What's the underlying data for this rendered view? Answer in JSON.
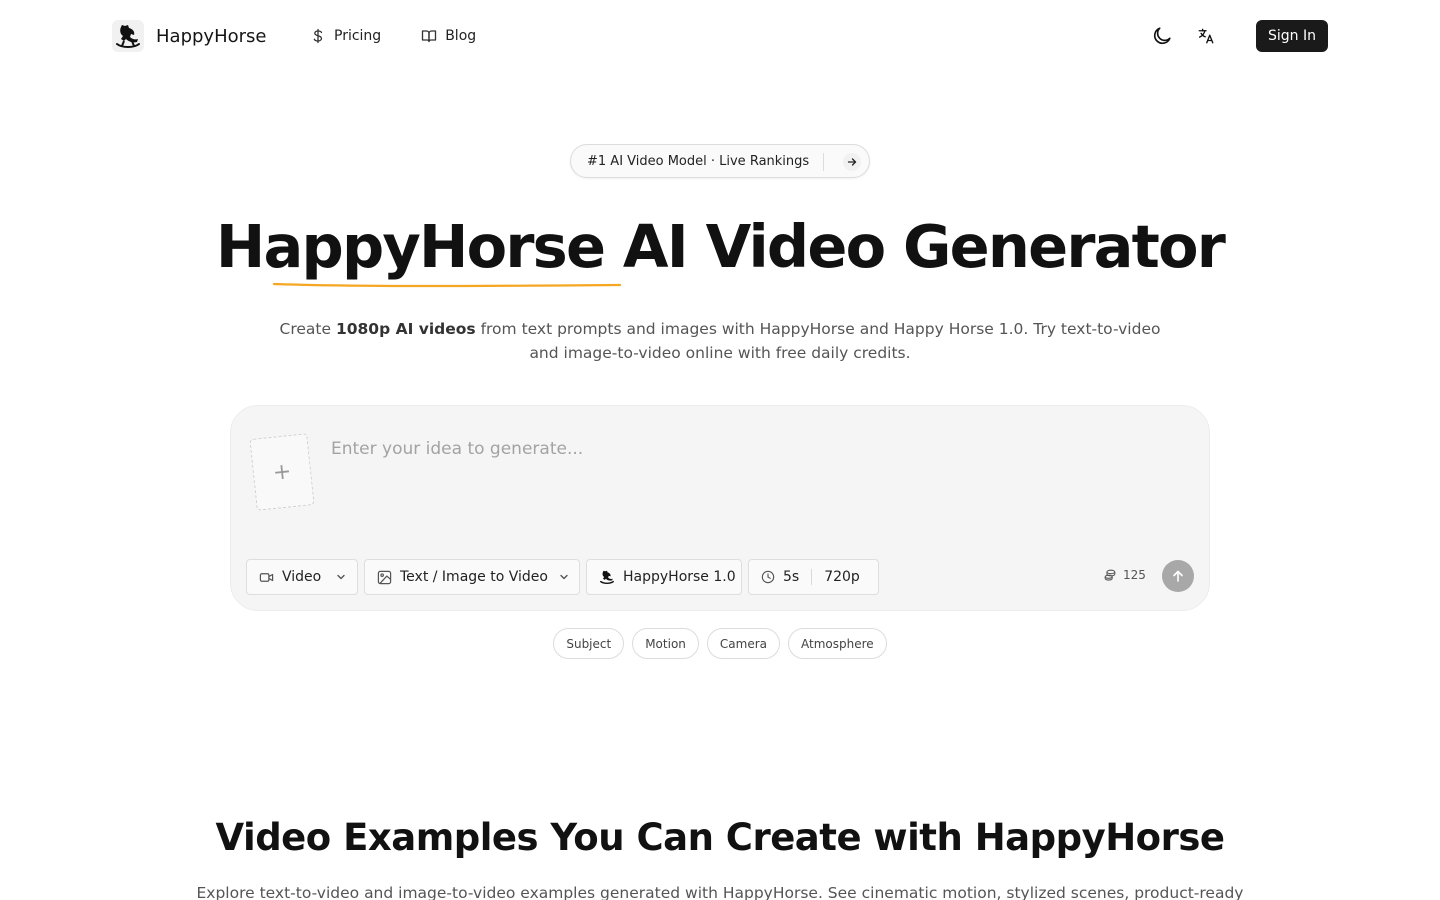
{
  "header": {
    "brand": "HappyHorse",
    "nav": [
      {
        "label": "Pricing",
        "icon": "dollar-icon"
      },
      {
        "label": "Blog",
        "icon": "book-icon"
      }
    ],
    "theme_toggle_icon": "moon-icon",
    "language_icon": "translate-icon",
    "sign_in_label": "Sign In"
  },
  "badge": {
    "text": "#1 AI Video Model · Live Rankings",
    "icon": "arrow-right-icon"
  },
  "hero": {
    "title_highlight": "HappyHorse",
    "title_rest": " AI Video Generator",
    "underline_color": "#f5a623",
    "subtitle_pre": "Create ",
    "subtitle_bold": "1080p AI videos",
    "subtitle_post": " from text prompts and images with HappyHorse and Happy Horse 1.0. Try text-to-video and image-to-video online with free daily credits."
  },
  "prompt": {
    "upload_symbol": "+",
    "placeholder": "Enter your idea to generate...",
    "controls": {
      "media_type": "Video",
      "mode": "Text / Image to Video",
      "model": "HappyHorse 1.0",
      "duration": "5s",
      "resolution": "720p"
    },
    "credits": "125"
  },
  "chips": [
    "Subject",
    "Motion",
    "Camera",
    "Atmosphere"
  ],
  "examples": {
    "title": "Video Examples You Can Create with HappyHorse",
    "subtitle": "Explore text-to-video and image-to-video examples generated with HappyHorse. See cinematic motion, stylized scenes, product-ready"
  }
}
